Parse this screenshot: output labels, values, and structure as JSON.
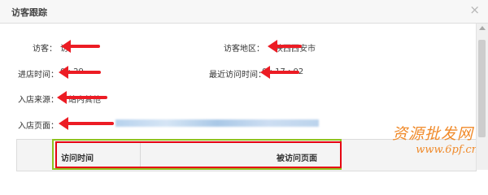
{
  "dialog": {
    "title": "访客跟踪",
    "close_glyph": "×"
  },
  "fields": {
    "visitor_label": "访客：",
    "visitor_value": "访",
    "region_label": "访客地区：",
    "region_value": "陕西西安市",
    "enter_time_label": "进店时间：",
    "enter_time_value": "0 : 29",
    "last_visit_label": "最近访问时间：",
    "last_visit_value": "0 : 17 : 02",
    "source_label": "入店来源：",
    "source_value": "站内其他",
    "page_label": "入店页面："
  },
  "table": {
    "col_time": "访问时间",
    "col_page": "被访问页面"
  },
  "watermark": {
    "line1": "资源批发网",
    "line2": "www.6pf.cn"
  },
  "colors": {
    "annotation_red": "#ec1c24",
    "highlight_green": "#8fc31f",
    "watermark_orange": "#f08a2a"
  }
}
